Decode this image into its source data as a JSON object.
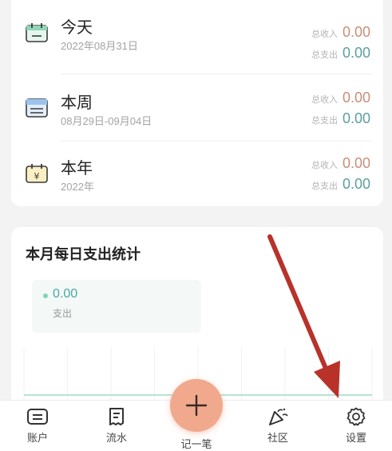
{
  "summary": {
    "rows": [
      {
        "title": "今天",
        "date": "2022年08月31日",
        "income_label": "总收入",
        "income": "0.00",
        "expense_label": "总支出",
        "expense": "0.00",
        "icon": "calendar-day-icon"
      },
      {
        "title": "本周",
        "date": "08月29日-09月04日",
        "income_label": "总收入",
        "income": "0.00",
        "expense_label": "总支出",
        "expense": "0.00",
        "icon": "calendar-week-icon"
      },
      {
        "title": "本年",
        "date": "2022年",
        "income_label": "总收入",
        "income": "0.00",
        "expense_label": "总支出",
        "expense": "0.00",
        "icon": "calendar-year-icon"
      }
    ]
  },
  "chart": {
    "title": "本月每日支出统计",
    "legend_value": "0.00",
    "legend_label": "支出"
  },
  "chart_data": {
    "type": "line",
    "series": [
      {
        "values": [
          0,
          0,
          0,
          0,
          0,
          0,
          0,
          0,
          0,
          0,
          0,
          0,
          0,
          0,
          0,
          0,
          0,
          0,
          0,
          0,
          0,
          0,
          0,
          0,
          0,
          0,
          0,
          0,
          0,
          0,
          0
        ]
      }
    ]
  },
  "tabbar": {
    "account": "账户",
    "flow": "流水",
    "record": "记一笔",
    "community": "社区",
    "settings": "设置"
  },
  "colors": {
    "income": "#c98e78",
    "expense": "#5b9ea2",
    "fab": "#f0a98d",
    "annotation_arrow": "#b8322a"
  }
}
